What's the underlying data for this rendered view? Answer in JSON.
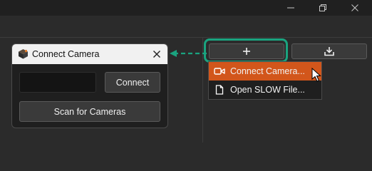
{
  "window": {
    "controls": [
      "minimize-icon",
      "restore-icon",
      "close-icon"
    ]
  },
  "toolbar": {
    "add_icon": "plus-icon",
    "import_icon": "download-tray-icon",
    "highlight_color": "#1aa37f"
  },
  "menu": {
    "items": [
      {
        "label": "Connect Camera...",
        "icon": "video-camera-icon",
        "active": true
      },
      {
        "label": "Open SLOW File...",
        "icon": "document-icon",
        "active": false
      }
    ],
    "active_color": "#d2561b"
  },
  "dialog": {
    "title": "Connect Camera",
    "app_icon": "cube-icon",
    "close_icon": "close-icon",
    "address_value": "",
    "connect_label": "Connect",
    "scan_label": "Scan for Cameras"
  }
}
